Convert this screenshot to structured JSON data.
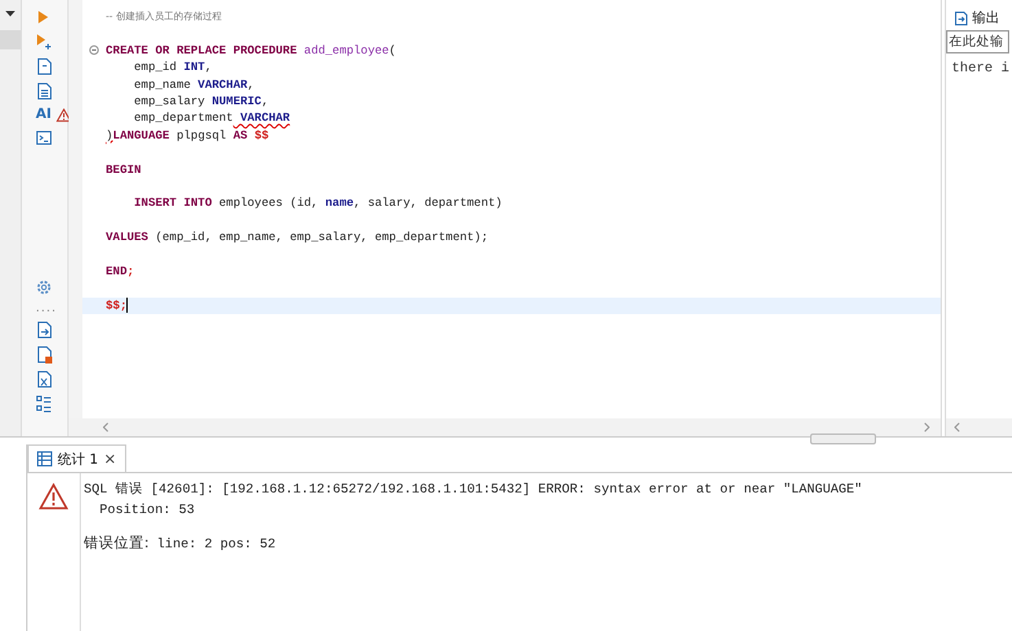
{
  "toolbar": {
    "ai_label": "AI",
    "more": "...."
  },
  "editor": {
    "lines": [
      {
        "kind": "code",
        "current": false,
        "segments": [
          {
            "text": "-- 创建插入员工的存储过程",
            "kind": "comment",
            "error": false
          }
        ]
      },
      {
        "kind": "blank",
        "current": false
      },
      {
        "kind": "code",
        "current": false,
        "folded": false,
        "segments": [
          {
            "text": "CREATE OR REPLACE PROCEDURE ",
            "kind": "keyword",
            "error": false
          },
          {
            "text": "add_employee",
            "kind": "function",
            "error": false
          },
          {
            "text": "(",
            "kind": "plain",
            "error": false
          }
        ]
      },
      {
        "kind": "code",
        "current": false,
        "segments": [
          {
            "text": "    emp_id ",
            "kind": "plain",
            "error": false
          },
          {
            "text": "INT",
            "kind": "type",
            "error": false
          },
          {
            "text": ",",
            "kind": "plain",
            "error": false
          }
        ]
      },
      {
        "kind": "code",
        "current": false,
        "segments": [
          {
            "text": "    emp_name ",
            "kind": "plain",
            "error": false
          },
          {
            "text": "VARCHAR",
            "kind": "type",
            "error": false
          },
          {
            "text": ",",
            "kind": "plain",
            "error": false
          }
        ]
      },
      {
        "kind": "code",
        "current": false,
        "segments": [
          {
            "text": "    emp_salary ",
            "kind": "plain",
            "error": false
          },
          {
            "text": "NUMERIC",
            "kind": "type",
            "error": false
          },
          {
            "text": ",",
            "kind": "plain",
            "error": false
          }
        ]
      },
      {
        "kind": "code",
        "current": false,
        "segments": [
          {
            "text": "    emp_department",
            "kind": "plain",
            "error": false
          },
          {
            "text": " VARCHAR",
            "kind": "type",
            "error": true
          }
        ]
      },
      {
        "kind": "code",
        "current": false,
        "segments": [
          {
            "text": ")",
            "kind": "plain",
            "error": true
          },
          {
            "text": "LANGUAGE ",
            "kind": "keyword",
            "error": false
          },
          {
            "text": "plpgsql ",
            "kind": "plain",
            "error": false
          },
          {
            "text": "AS ",
            "kind": "keyword",
            "error": false
          },
          {
            "text": "$$",
            "kind": "dollar",
            "error": false
          }
        ]
      },
      {
        "kind": "blank",
        "current": false
      },
      {
        "kind": "code",
        "current": false,
        "segments": [
          {
            "text": "BEGIN",
            "kind": "keyword",
            "error": false
          }
        ]
      },
      {
        "kind": "blank",
        "current": false
      },
      {
        "kind": "code",
        "current": false,
        "segments": [
          {
            "text": "    INSERT INTO ",
            "kind": "keyword",
            "error": false
          },
          {
            "text": "employees (id, ",
            "kind": "plain",
            "error": false
          },
          {
            "text": "name",
            "kind": "type",
            "error": false
          },
          {
            "text": ", salary, department)",
            "kind": "plain",
            "error": false
          }
        ]
      },
      {
        "kind": "blank",
        "current": false
      },
      {
        "kind": "code",
        "current": false,
        "segments": [
          {
            "text": "VALUES ",
            "kind": "keyword",
            "error": false
          },
          {
            "text": "(emp_id, emp_name, emp_salary, emp_department);",
            "kind": "plain",
            "error": false
          }
        ]
      },
      {
        "kind": "blank",
        "current": false
      },
      {
        "kind": "code",
        "current": false,
        "segments": [
          {
            "text": "END",
            "kind": "keyword",
            "error": false
          },
          {
            "text": ";",
            "kind": "dollar",
            "error": false
          }
        ]
      },
      {
        "kind": "blank",
        "current": false
      },
      {
        "kind": "code",
        "current": true,
        "segments": [
          {
            "text": "$$;",
            "kind": "dollar",
            "error": false
          }
        ]
      }
    ]
  },
  "output_panel": {
    "tab": "输出",
    "input_placeholder": "在此处输",
    "text": "there i"
  },
  "results": {
    "tabs": [
      {
        "label": "统计 1",
        "selected": true,
        "close": "×"
      }
    ],
    "error_lines": [
      "SQL 错误 [42601]: [192.168.1.12:65272/192.168.1.101:5432] ERROR: syntax error at or near \"LANGUAGE\"",
      "  Position: 53"
    ],
    "location": {
      "label": "错误位置:",
      "text": " line: 2 pos: 52"
    }
  }
}
